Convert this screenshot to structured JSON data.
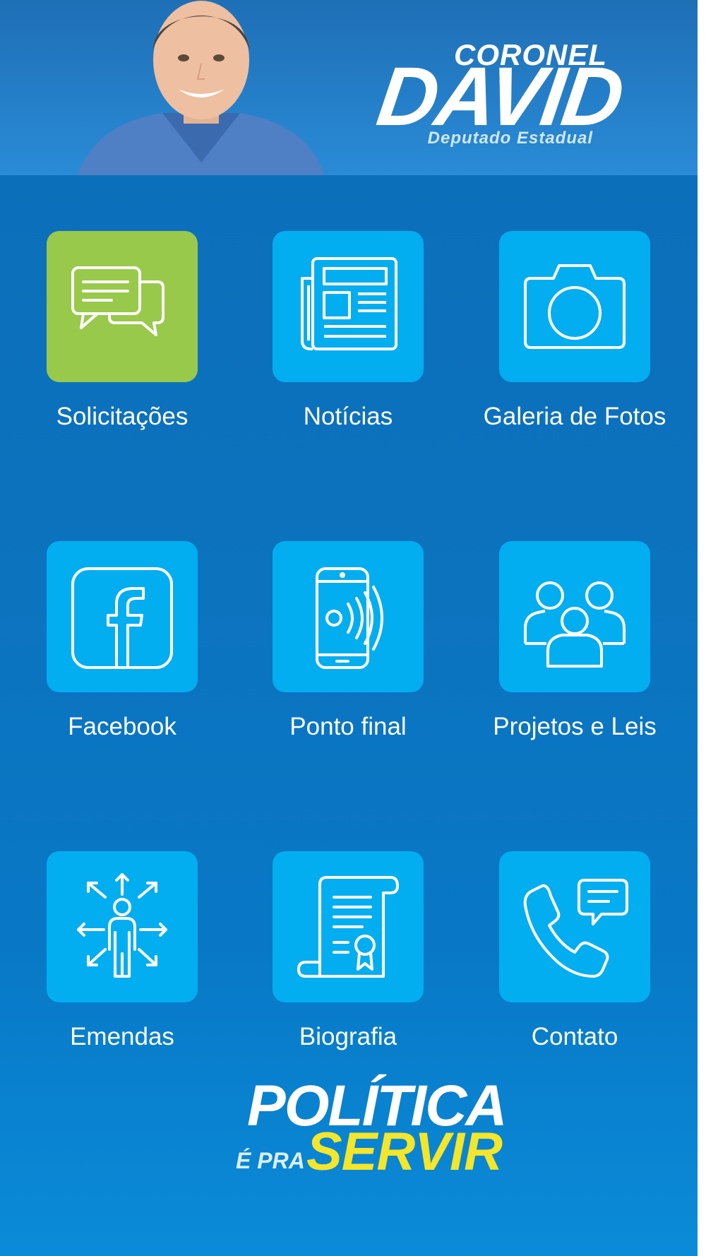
{
  "header": {
    "logo_top": "CORONEL",
    "logo_main": "DAVID",
    "logo_sub": "Deputado Estadual"
  },
  "menu": [
    {
      "label": "Solicitações",
      "icon": "chat-bubbles-icon",
      "color": "#98c94b"
    },
    {
      "label": "Notícias",
      "icon": "newspaper-icon",
      "color": "#03aef0"
    },
    {
      "label": "Galeria de Fotos",
      "icon": "camera-icon",
      "color": "#03aef0"
    },
    {
      "label": "Facebook",
      "icon": "facebook-icon",
      "color": "#03aef0"
    },
    {
      "label": "Ponto final",
      "icon": "smartphone-audio-icon",
      "color": "#03aef0"
    },
    {
      "label": "Projetos e Leis",
      "icon": "group-icon",
      "color": "#03aef0"
    },
    {
      "label": "Emendas",
      "icon": "person-arrows-icon",
      "color": "#03aef0"
    },
    {
      "label": "Biografia",
      "icon": "certificate-scroll-icon",
      "color": "#03aef0"
    },
    {
      "label": "Contato",
      "icon": "phone-message-icon",
      "color": "#03aef0"
    }
  ],
  "slogan": {
    "line1": "POLÍTICA",
    "line2": "É PRA",
    "line3": "SERVIR"
  },
  "colors": {
    "background": "#0a6db9",
    "tile": "#03aef0",
    "tile_highlight": "#98c94b",
    "slogan_accent": "#f4e62a"
  }
}
